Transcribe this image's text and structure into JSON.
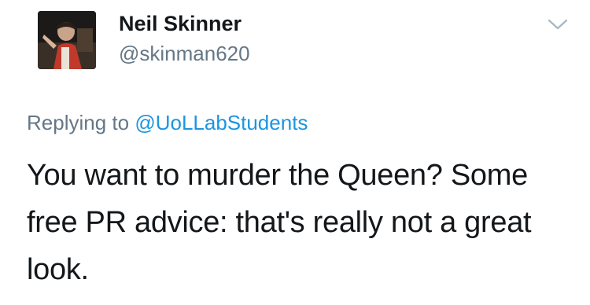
{
  "author": {
    "name": "Neil Skinner",
    "handle": "@skinman620",
    "avatar_alt": "profile photo"
  },
  "header": {
    "menu_icon": "chevron-down-icon"
  },
  "reply": {
    "prefix": "Replying to",
    "mention": "@UoLLabStudents"
  },
  "tweet": {
    "text": "You want to murder the Queen? Some free PR advice: that's really not a great look."
  },
  "colors": {
    "text_primary": "#14171a",
    "text_secondary": "#657786",
    "link": "#1b95e0",
    "chevron": "#aab8c2"
  }
}
